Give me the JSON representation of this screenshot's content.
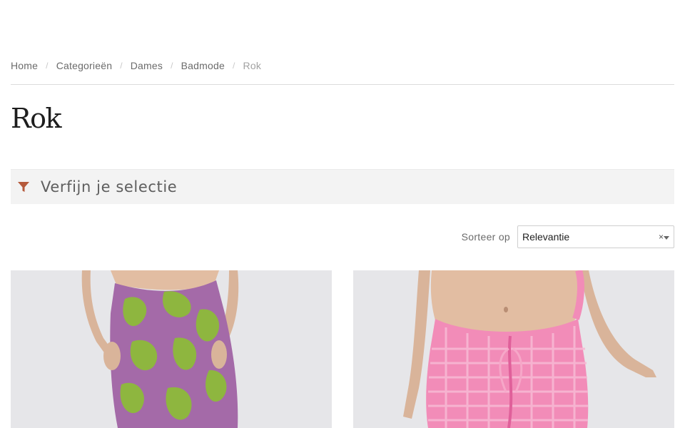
{
  "breadcrumb": {
    "items": [
      {
        "label": "Home"
      },
      {
        "label": "Categorieën"
      },
      {
        "label": "Dames"
      },
      {
        "label": "Badmode"
      },
      {
        "label": "Rok"
      }
    ],
    "separator": "/"
  },
  "page": {
    "title": "Rok"
  },
  "filter": {
    "label": "Verfijn je selectie",
    "icon": "funnel-icon",
    "icon_color": "#b55a3c"
  },
  "sort": {
    "label": "Sorteer op",
    "selected": "Relevantie",
    "clear": "×"
  },
  "products": [
    {
      "image": "green-purple-printed-sarong-skirt"
    },
    {
      "image": "pink-textured-ruched-skirt"
    }
  ]
}
